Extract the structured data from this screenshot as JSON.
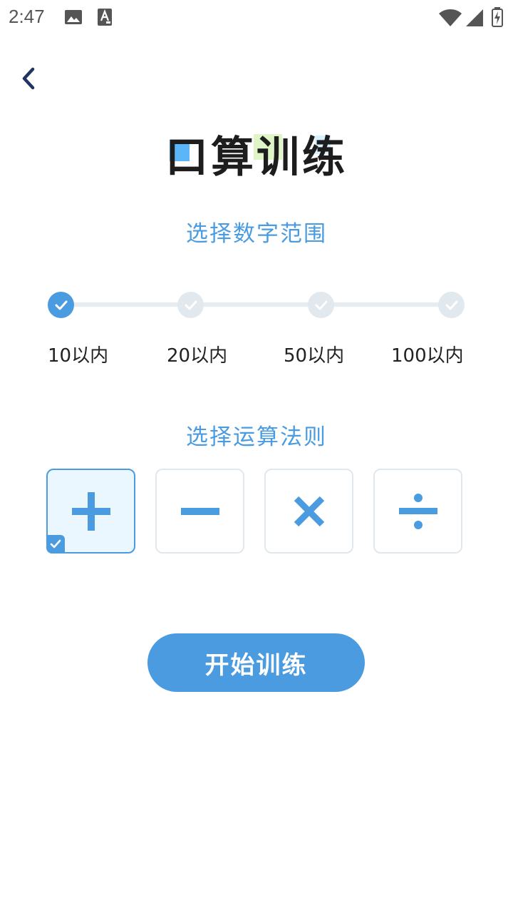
{
  "status_bar": {
    "time": "2:47",
    "icons": [
      "image-icon",
      "a-icon",
      "wifi-icon",
      "signal-icon",
      "battery-charging-icon"
    ]
  },
  "header": {
    "back_icon": "chevron-left-icon",
    "title": "口算训练"
  },
  "range": {
    "heading": "选择数字范围",
    "options": [
      {
        "label": "10以内",
        "selected": true
      },
      {
        "label": "20以内",
        "selected": false
      },
      {
        "label": "50以内",
        "selected": false
      },
      {
        "label": "100以内",
        "selected": false
      }
    ]
  },
  "operations": {
    "heading": "选择运算法则",
    "items": [
      {
        "symbol": "plus-icon",
        "selected": true
      },
      {
        "symbol": "minus-icon",
        "selected": false
      },
      {
        "symbol": "multiply-icon",
        "selected": false
      },
      {
        "symbol": "divide-icon",
        "selected": false
      }
    ]
  },
  "start_button": {
    "label": "开始训练"
  },
  "colors": {
    "accent": "#4a9be0",
    "inactive": "#e1e9ef",
    "selected_bg": "#eaf7fe",
    "title": "#1d1d1d",
    "back_arrow": "#1f3560"
  }
}
